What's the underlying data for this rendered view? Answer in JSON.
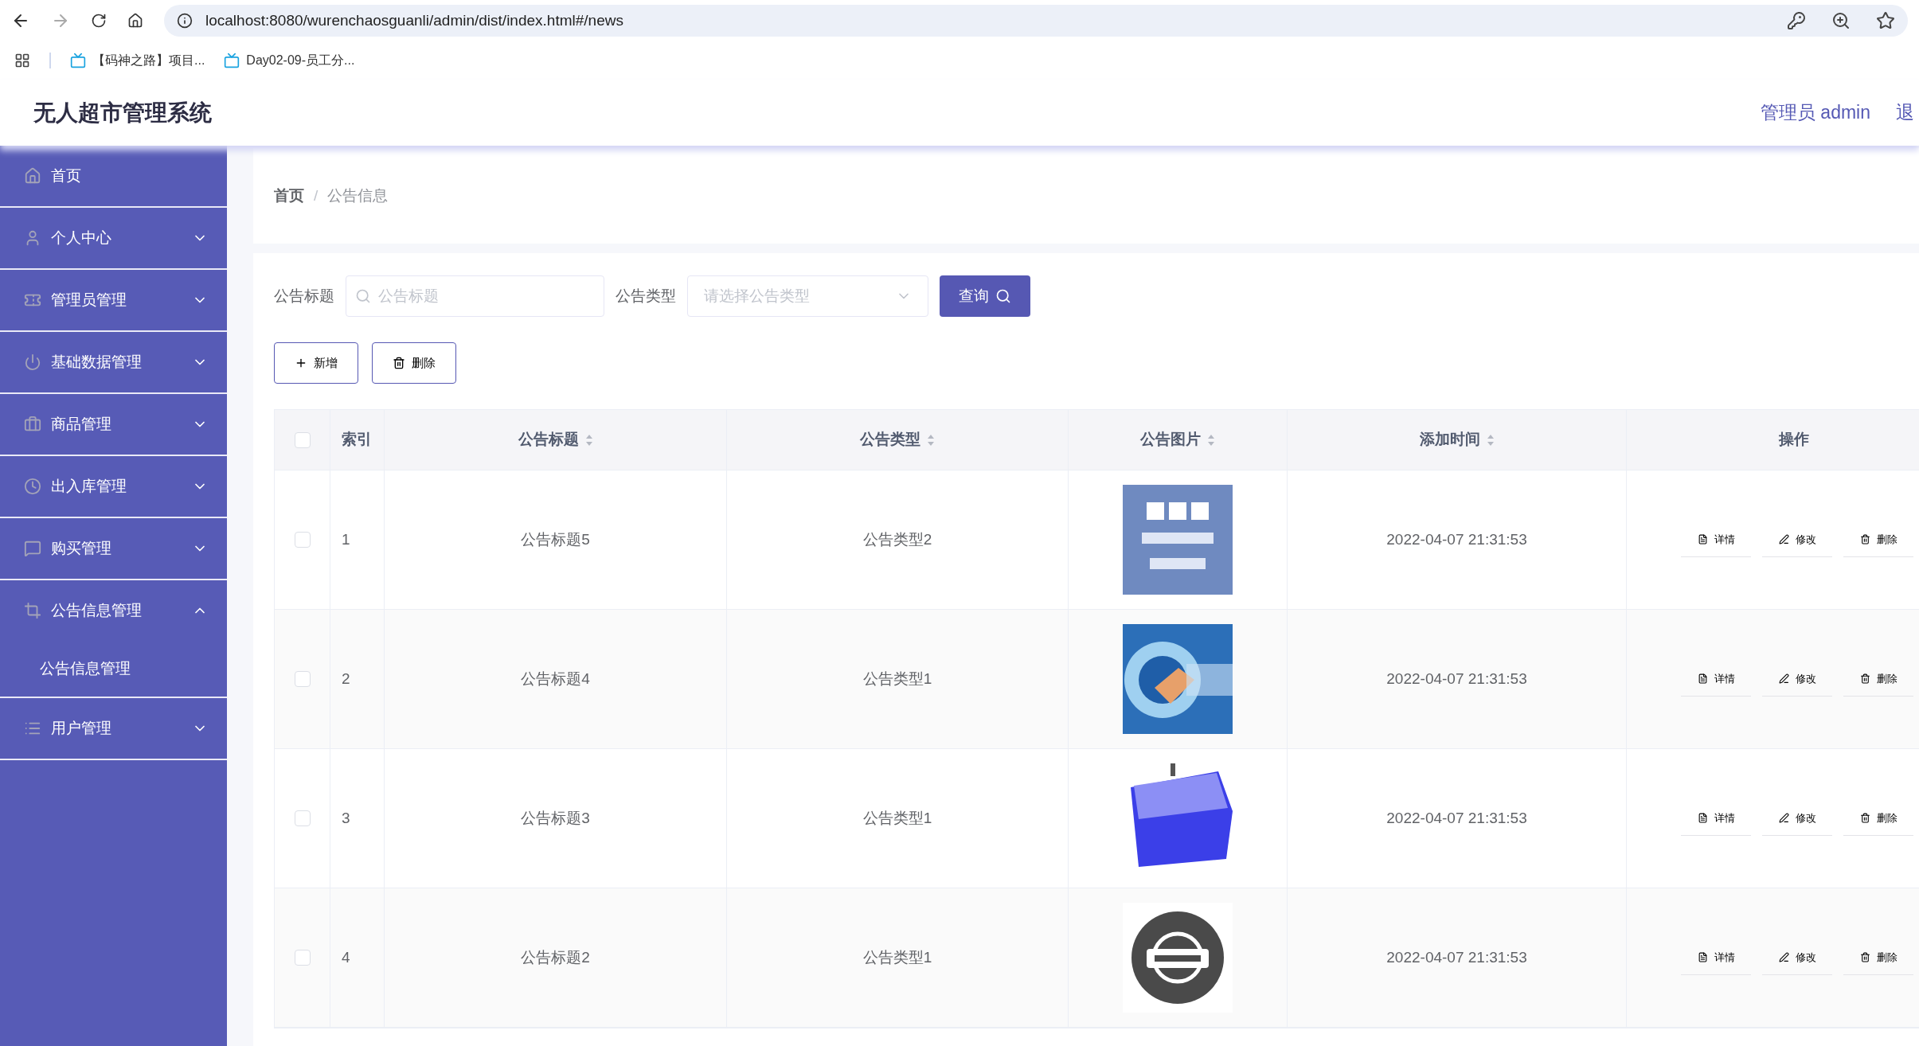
{
  "browser": {
    "url": "localhost:8080/wurenchaosguanli/admin/dist/index.html#/news",
    "bookmarks": [
      "【码神之路】项目...",
      "Day02-09-员工分..."
    ]
  },
  "header": {
    "title": "无人超市管理系统",
    "user": "管理员 admin",
    "logout": "退"
  },
  "sidebar": {
    "items": [
      {
        "label": "首页",
        "kind": "link"
      },
      {
        "label": "个人中心",
        "kind": "submenu",
        "expanded": false
      },
      {
        "label": "管理员管理",
        "kind": "submenu",
        "expanded": false
      },
      {
        "label": "基础数据管理",
        "kind": "submenu",
        "expanded": false
      },
      {
        "label": "商品管理",
        "kind": "submenu",
        "expanded": false
      },
      {
        "label": "出入库管理",
        "kind": "submenu",
        "expanded": false
      },
      {
        "label": "购买管理",
        "kind": "submenu",
        "expanded": false
      },
      {
        "label": "公告信息管理",
        "kind": "submenu",
        "expanded": true,
        "children": [
          {
            "label": "公告信息管理"
          }
        ]
      },
      {
        "label": "用户管理",
        "kind": "submenu",
        "expanded": false
      }
    ]
  },
  "breadcrumb": {
    "items": [
      "首页",
      "公告信息"
    ],
    "separator": "/"
  },
  "filters": {
    "title_label": "公告标题",
    "title_placeholder": "公告标题",
    "type_label": "公告类型",
    "type_placeholder": "请选择公告类型",
    "search_button": "查询"
  },
  "toolbar": {
    "add": "新增",
    "delete": "删除"
  },
  "table": {
    "select_all_checked": false,
    "columns": [
      {
        "label": "索引",
        "sortable": false
      },
      {
        "label": "公告标题",
        "sortable": true
      },
      {
        "label": "公告类型",
        "sortable": true
      },
      {
        "label": "公告图片",
        "sortable": true
      },
      {
        "label": "添加时间",
        "sortable": true
      },
      {
        "label": "操作",
        "sortable": false
      }
    ],
    "rows": [
      {
        "index": "1",
        "title": "公告标题5",
        "type": "公告类型2",
        "picture": {
          "kind": "picture"
        },
        "time": "2022-04-07 21:31:53",
        "actions": [
          "详情",
          "修改",
          "删除"
        ],
        "checked": false
      },
      {
        "index": "2",
        "title": "公告标题4",
        "type": "公告类型1",
        "picture": {
          "kind": "picture"
        },
        "time": "2022-04-07 21:31:53",
        "actions": [
          "详情",
          "修改",
          "删除"
        ],
        "checked": false
      },
      {
        "index": "3",
        "title": "公告标题3",
        "type": "公告类型1",
        "picture": {
          "kind": "picture"
        },
        "time": "2022-04-07 21:31:53",
        "actions": [
          "详情",
          "修改",
          "删除"
        ],
        "checked": false
      },
      {
        "index": "4",
        "title": "公告标题2",
        "type": "公告类型1",
        "picture": {
          "kind": "picture"
        },
        "time": "2022-04-07 21:31:53",
        "actions": [
          "详情",
          "修改",
          "删除"
        ],
        "checked": false
      }
    ]
  }
}
